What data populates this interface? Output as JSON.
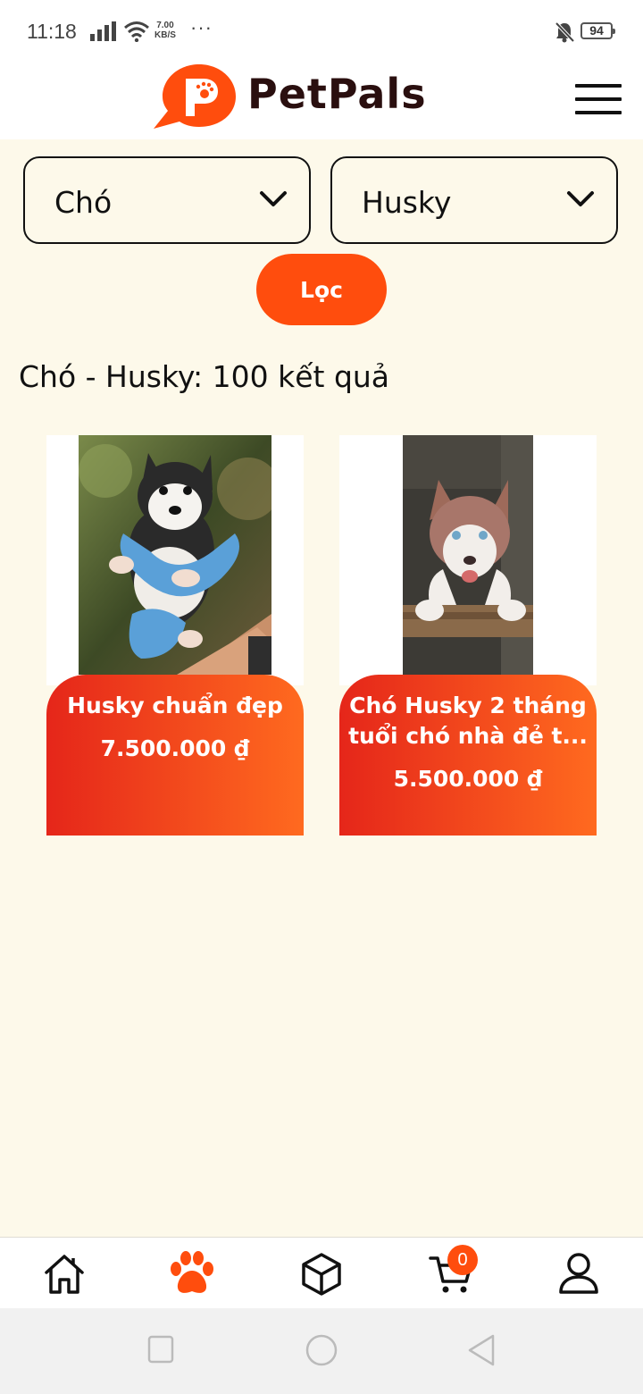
{
  "status_bar": {
    "time": "11:18",
    "net_speed_value": "7.00",
    "net_speed_unit": "KB/S",
    "dots": "···",
    "battery": "94"
  },
  "header": {
    "app_name": "PetPals",
    "logo_color": "#ff4d0d"
  },
  "filters": {
    "category": "Chó",
    "breed": "Husky",
    "filter_button": "Lọc"
  },
  "results": {
    "title": "Chó - Husky: 100 kết quả"
  },
  "products": [
    {
      "name": "Husky chuẩn đẹp",
      "price": "7.500.000 ₫"
    },
    {
      "name": "Chó Husky 2 tháng tuổi chó nhà đẻ t...",
      "price": "5.500.000 ₫"
    }
  ],
  "bottom_nav": {
    "active": "pets",
    "cart_count": "0",
    "items": [
      "home-icon",
      "paw-icon",
      "box-icon",
      "cart-icon",
      "user-icon"
    ]
  },
  "colors": {
    "accent": "#ff4d0d",
    "background": "#fdf9ea",
    "card_gradient_start": "#e5261a",
    "card_gradient_end": "#ff6a1f"
  }
}
